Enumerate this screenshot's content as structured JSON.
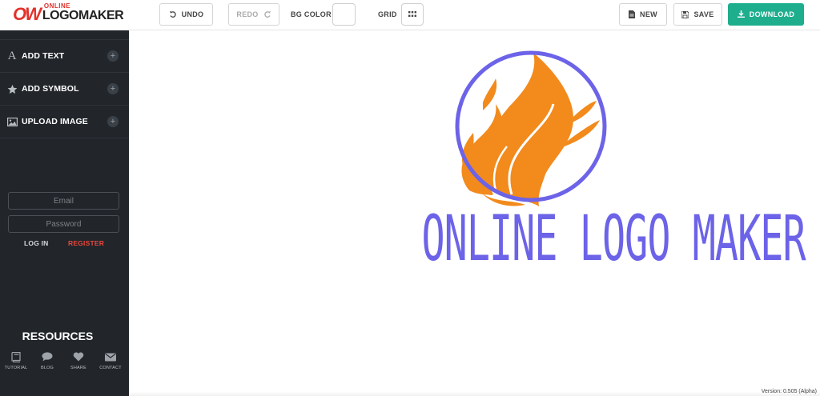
{
  "app": {
    "logo_mark": "OW",
    "logo_small": "ONLINE",
    "logo_big": "LOGOMAKER"
  },
  "toolbar": {
    "undo_label": "UNDO",
    "redo_label": "REDO",
    "bg_color_label": "BG COLOR",
    "grid_label": "GRID",
    "new_label": "NEW",
    "save_label": "SAVE",
    "download_label": "DOWNLOAD",
    "download_color": "#1eae8e"
  },
  "sidebar": {
    "items": [
      {
        "label": "ADD TEXT",
        "icon": "text-icon"
      },
      {
        "label": "ADD SYMBOL",
        "icon": "star-icon"
      },
      {
        "label": "UPLOAD IMAGE",
        "icon": "image-icon"
      }
    ],
    "login": {
      "email_placeholder": "Email",
      "password_placeholder": "Password",
      "login_label": "LOG IN",
      "register_label": "REGISTER",
      "register_color": "#e8453c"
    },
    "resources": {
      "title": "RESOURCES",
      "items": [
        {
          "label": "TUTORIAL",
          "icon": "book-icon"
        },
        {
          "label": "BLOG",
          "icon": "chat-bubble-icon"
        },
        {
          "label": "SHARE",
          "icon": "heart-icon"
        },
        {
          "label": "CONTACT",
          "icon": "envelope-icon"
        }
      ]
    }
  },
  "canvas": {
    "logo_text": "ONLINE LOGO MAKER",
    "text_color": "#6c63e8",
    "ring_color": "#6c63e8",
    "flame_color": "#f28a1c",
    "version": "Version: 0.505 (Alpha)"
  }
}
